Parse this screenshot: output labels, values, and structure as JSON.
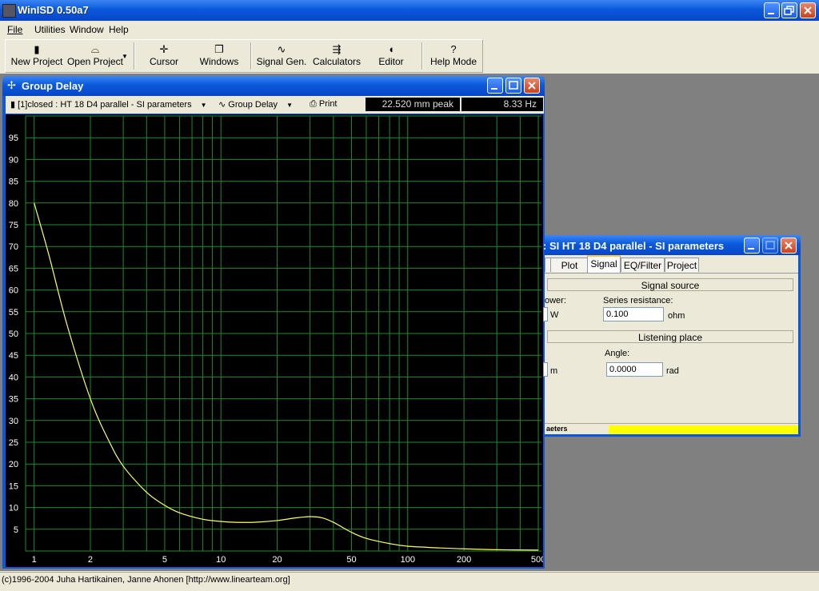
{
  "app": {
    "title": "WinISD 0.50a7"
  },
  "menu": [
    "File",
    "Utilities",
    "Window",
    "Help"
  ],
  "toolbar": [
    {
      "label": "New Project",
      "icon": "new-project-icon"
    },
    {
      "label": "Open Project",
      "icon": "open-folder-icon"
    },
    {
      "label": "Cursor",
      "icon": "cursor-icon"
    },
    {
      "label": "Windows",
      "icon": "windows-icon"
    },
    {
      "label": "Signal Gen.",
      "icon": "sine-wave-icon"
    },
    {
      "label": "Calculators",
      "icon": "calculator-icon"
    },
    {
      "label": "Editor",
      "icon": "speaker-icon"
    },
    {
      "label": "Help Mode",
      "icon": "question-icon",
      "glyph": "?"
    }
  ],
  "group_delay": {
    "title": "Group Delay",
    "project_select": "[1]closed : HT 18 D4 parallel - SI parameters",
    "plot_select": "Group Delay",
    "print_label": "Print",
    "readout_value": "22.520 mm peak",
    "readout_freq": "8.33 Hz"
  },
  "chart_data": {
    "type": "line",
    "xscale": "log",
    "xlim": [
      0.9,
      520
    ],
    "ylim": [
      0,
      100
    ],
    "x_ticks": [
      1,
      2,
      5,
      10,
      20,
      50,
      100,
      200,
      500
    ],
    "y_ticks": [
      5,
      10,
      15,
      20,
      25,
      30,
      35,
      40,
      45,
      50,
      55,
      60,
      65,
      70,
      75,
      80,
      85,
      90,
      95
    ],
    "grid": true,
    "series": [
      {
        "color": "#ffff66",
        "x": [
          1,
          1.2,
          1.5,
          2,
          2.5,
          3,
          4,
          5,
          6,
          8,
          10,
          12,
          15,
          20,
          25,
          30,
          35,
          40,
          50,
          60,
          80,
          100,
          150,
          200,
          300,
          500
        ],
        "y": [
          80,
          68,
          52,
          35,
          25.5,
          19.5,
          13.5,
          10.5,
          8.8,
          7.3,
          6.8,
          6.6,
          6.6,
          7,
          7.6,
          7.9,
          7.6,
          6.6,
          4.3,
          2.9,
          1.7,
          1.1,
          0.7,
          0.5,
          0.3,
          0.2
        ]
      }
    ]
  },
  "signal_window": {
    "title": ": SI HT 18 D4 parallel - SI parameters",
    "tabs": [
      "Plot",
      "Signal",
      "EQ/Filter",
      "Project"
    ],
    "active_tab": "Signal",
    "signal_source_header": "Signal source",
    "power_label": "ower:",
    "power_unit": "W",
    "series_resistance_label": "Series resistance:",
    "series_resistance_value": "0.100",
    "series_resistance_unit": "ohm",
    "listening_place_header": "Listening place",
    "distance_unit": "m",
    "angle_label": "Angle:",
    "angle_value": "0.0000",
    "angle_unit": "rad",
    "status_text": "aeters"
  },
  "statusbar": {
    "text": "(c)1996-2004 Juha Hartikainen, Janne Ahonen [http://www.linearteam.org]"
  },
  "colors": {
    "plot_bg": "#000000",
    "grid": "#1f8a2a",
    "curve": "#ffff66",
    "titlebar": "#0a59dc"
  }
}
